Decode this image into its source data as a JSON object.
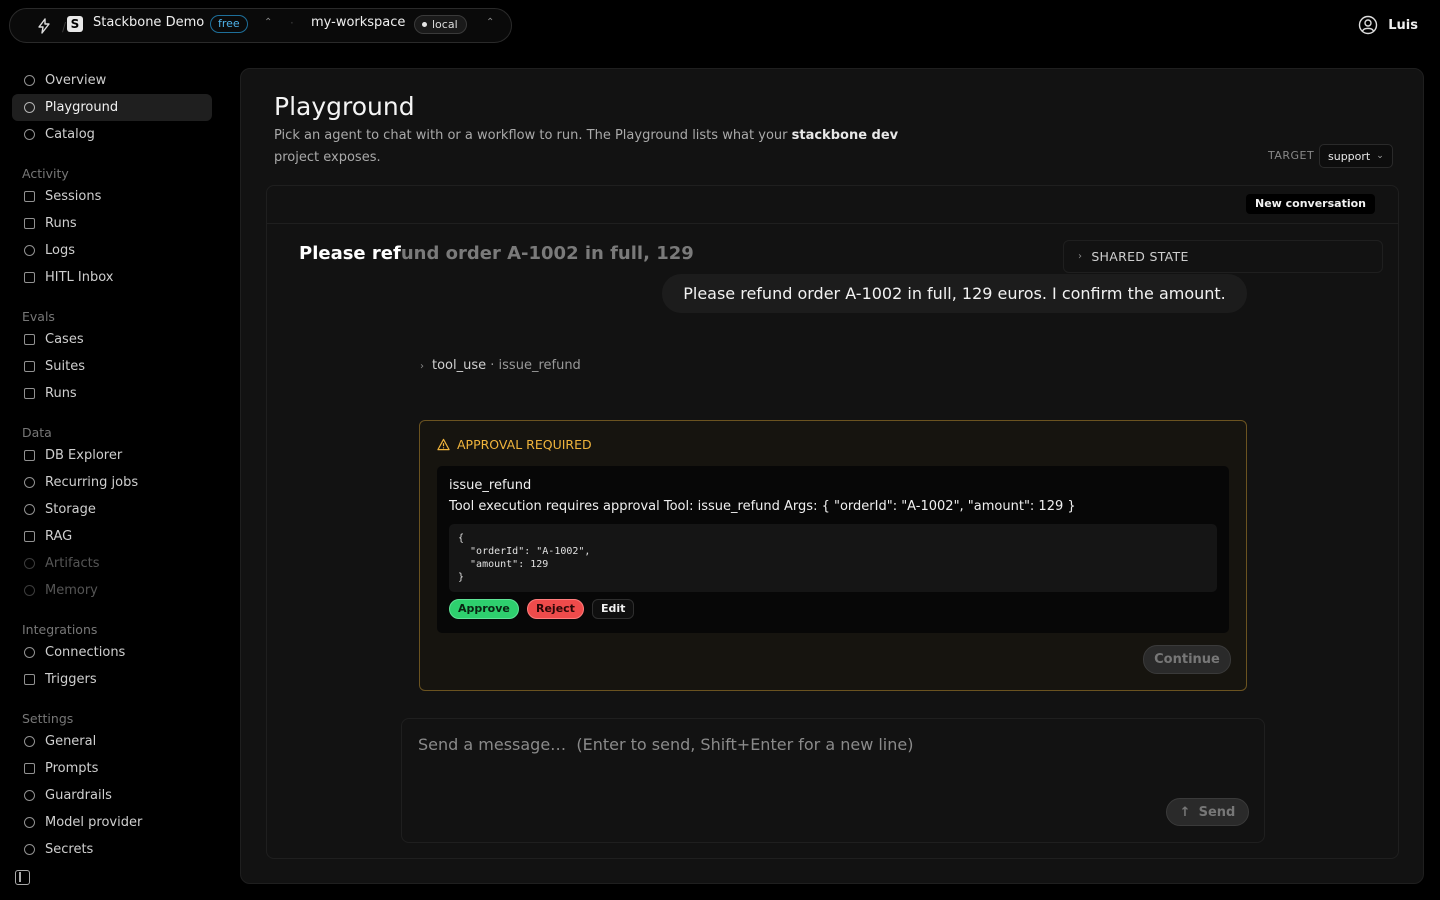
{
  "topbar": {
    "project_name": "Stackbone Demo",
    "project_icon_letter": "S",
    "plan_badge": "free",
    "workspace_name": "my-workspace",
    "env_badge": "local",
    "user_name": "Luis"
  },
  "sidebar": {
    "top": [
      {
        "label": "Overview",
        "icon": "info-icon"
      },
      {
        "label": "Playground",
        "icon": "play-icon",
        "active": true
      },
      {
        "label": "Catalog",
        "icon": "catalog-icon"
      }
    ],
    "groups": [
      {
        "title": "Activity",
        "items": [
          {
            "label": "Sessions",
            "icon": "list-icon"
          },
          {
            "label": "Runs",
            "icon": "runs-icon"
          },
          {
            "label": "Logs",
            "icon": "logs-icon"
          },
          {
            "label": "HITL Inbox",
            "icon": "inbox-icon"
          }
        ]
      },
      {
        "title": "Evals",
        "items": [
          {
            "label": "Cases",
            "icon": "cases-icon"
          },
          {
            "label": "Suites",
            "icon": "suites-icon"
          },
          {
            "label": "Runs",
            "icon": "chart-icon"
          }
        ]
      },
      {
        "title": "Data",
        "items": [
          {
            "label": "DB Explorer",
            "icon": "database-icon"
          },
          {
            "label": "Recurring jobs",
            "icon": "clock-icon"
          },
          {
            "label": "Storage",
            "icon": "storage-icon"
          },
          {
            "label": "RAG",
            "icon": "rag-icon"
          },
          {
            "label": "Artifacts",
            "icon": "artifacts-icon",
            "disabled": true
          },
          {
            "label": "Memory",
            "icon": "memory-icon",
            "disabled": true
          }
        ]
      },
      {
        "title": "Integrations",
        "items": [
          {
            "label": "Connections",
            "icon": "link-icon"
          },
          {
            "label": "Triggers",
            "icon": "trigger-icon"
          }
        ]
      },
      {
        "title": "Settings",
        "items": [
          {
            "label": "General",
            "icon": "gear-icon"
          },
          {
            "label": "Prompts",
            "icon": "prompt-icon"
          },
          {
            "label": "Guardrails",
            "icon": "guardrail-icon"
          },
          {
            "label": "Model provider",
            "icon": "model-icon"
          },
          {
            "label": "Secrets",
            "icon": "key-icon"
          }
        ]
      }
    ]
  },
  "main": {
    "title": "Playground",
    "desc_pre": "Pick an agent to chat with or a workflow to run. The Playground lists what your ",
    "desc_project": "stackbone dev",
    "desc_post": " project exposes.",
    "target_label": "TARGET",
    "target_value": "support",
    "new_conversation": "New conversation",
    "ghost_title_solid": "Please ref",
    "ghost_title_fade": "und order A-1002 in full, 129",
    "shared_state": "SHARED STATE",
    "user_message": "Please refund order A-1002 in full, 129 euros. I confirm the amount.",
    "tool_use_label": "tool_use",
    "tool_use_name": "· issue_refund",
    "approval": {
      "title": "APPROVAL REQUIRED",
      "tool": "issue_refund",
      "message": "Tool execution requires approval Tool: issue_refund Args: { \"orderId\": \"A-1002\", \"amount\": 129 }",
      "args": "{\n  \"orderId\": \"A-1002\",\n  \"amount\": 129\n}",
      "approve": "Approve",
      "reject": "Reject",
      "edit": "Edit",
      "continue": "Continue"
    },
    "composer": {
      "placeholder": "Send a message…  (Enter to send, Shift+Enter for a new line)",
      "send": "Send"
    }
  },
  "colors": {
    "approve": "#2ed06e",
    "reject": "#ef4b4b",
    "warning": "#f0b43c",
    "free_badge": "#4fb3ea"
  }
}
